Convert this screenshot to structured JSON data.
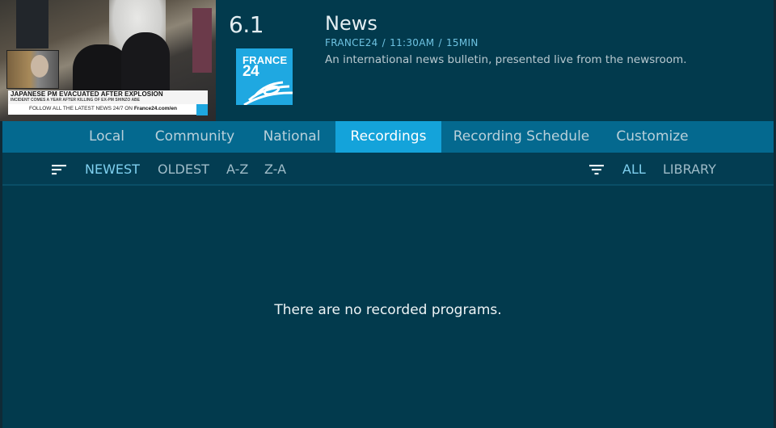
{
  "preview": {
    "headline": "JAPANESE PM EVACUATED AFTER EXPLOSION",
    "subheadline": "INCIDENT COMES A YEAR AFTER KILLING OF EX-PM SHINZO ABE",
    "ticker_prefix": "FOLLOW ALL THE LATEST NEWS 24/7 ON ",
    "ticker_url": "France24.com/en"
  },
  "program": {
    "channel_number": "6.1",
    "logo": {
      "line1": "FRANCE",
      "line2": "24",
      "color": "#1fa8e1"
    },
    "title": "News",
    "meta": "FRANCE24  /  11:30AM  /  15MIN",
    "description": "An international news bulletin, presented live from the newsroom."
  },
  "tabs": [
    {
      "label": "Local",
      "active": false
    },
    {
      "label": "Community",
      "active": false
    },
    {
      "label": "National",
      "active": false
    },
    {
      "label": "Recordings",
      "active": true
    },
    {
      "label": "Recording Schedule",
      "active": false
    },
    {
      "label": "Customize",
      "active": false
    }
  ],
  "sort": {
    "icon": "sort-icon",
    "options": [
      {
        "label": "NEWEST",
        "selected": true
      },
      {
        "label": "OLDEST",
        "selected": false
      },
      {
        "label": "A-Z",
        "selected": false
      },
      {
        "label": "Z-A",
        "selected": false
      }
    ]
  },
  "filter": {
    "icon": "filter-icon",
    "options": [
      {
        "label": "ALL",
        "selected": true
      },
      {
        "label": "LIBRARY",
        "selected": false
      }
    ]
  },
  "empty_message": "There are no recorded programs.",
  "colors": {
    "background": "#023a4d",
    "tab_bar": "#04698f",
    "tab_active": "#14a3da",
    "accent_text": "#6fc3e2"
  }
}
